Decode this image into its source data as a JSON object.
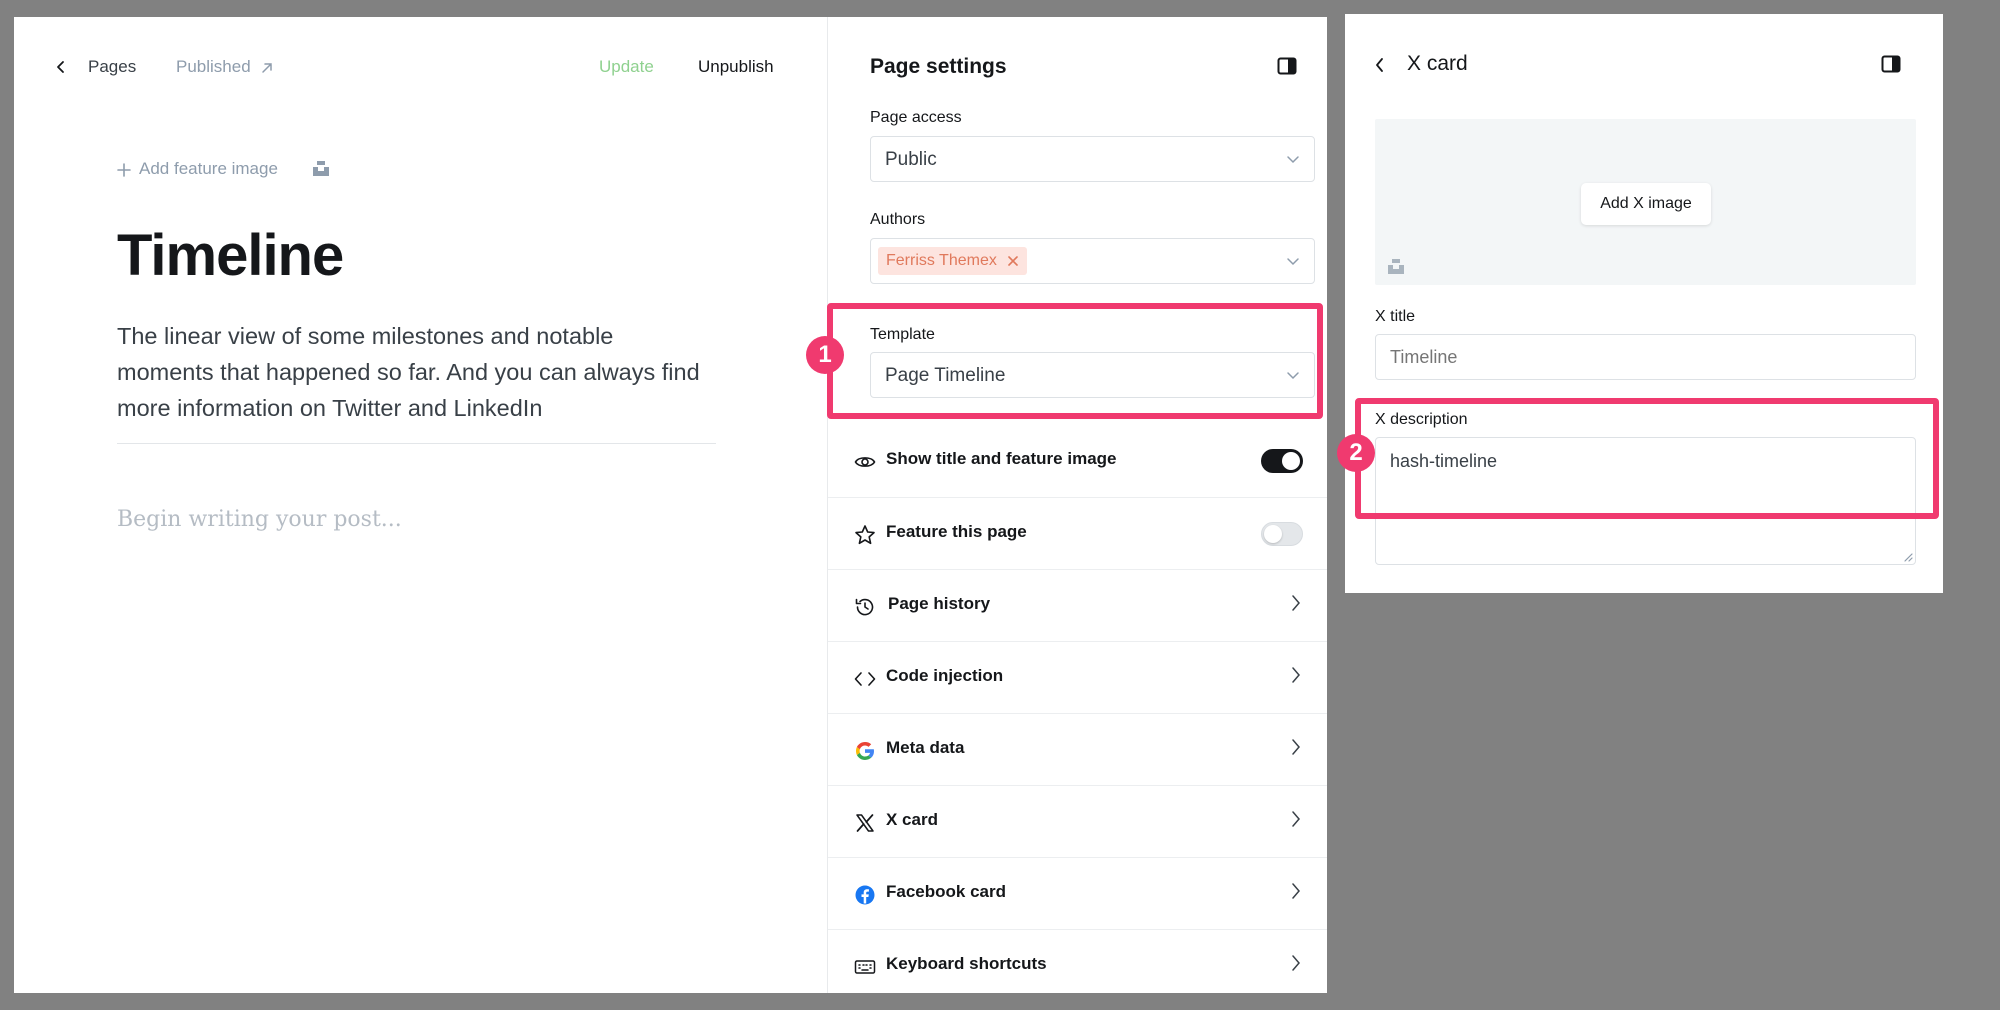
{
  "editor": {
    "back_label": "Pages",
    "status_label": "Published",
    "update_label": "Update",
    "unpublish_label": "Unpublish",
    "add_feature_image_label": "Add feature image",
    "title": "Timeline",
    "excerpt": "The linear view of some milestones and notable moments that happened so far. And you can always find more information on Twitter and LinkedIn",
    "body_placeholder": "Begin writing your post..."
  },
  "settings": {
    "heading": "Page settings",
    "page_access": {
      "label": "Page access",
      "value": "Public"
    },
    "authors": {
      "label": "Authors",
      "tag": "Ferriss Themex"
    },
    "template": {
      "label": "Template",
      "value": "Page Timeline"
    },
    "show_title": {
      "label": "Show title and feature image",
      "enabled": true
    },
    "feature_page": {
      "label": "Feature this page",
      "enabled": false
    },
    "menu": [
      {
        "label": "Page history",
        "icon": "history-icon"
      },
      {
        "label": "Code injection",
        "icon": "code-icon"
      },
      {
        "label": "Meta data",
        "icon": "google-icon"
      },
      {
        "label": "X card",
        "icon": "x-logo-icon"
      },
      {
        "label": "Facebook card",
        "icon": "facebook-icon"
      },
      {
        "label": "Keyboard shortcuts",
        "icon": "keyboard-icon"
      }
    ]
  },
  "xcard": {
    "title": "X card",
    "add_image_label": "Add X image",
    "x_title_label": "X title",
    "x_title_placeholder": "Timeline",
    "x_description_label": "X description",
    "x_description_value": "hash-timeline"
  },
  "annotations": [
    {
      "number": "1"
    },
    {
      "number": "2"
    }
  ],
  "colors": {
    "highlight": "#f03a6f",
    "update_green": "#8fd18f",
    "author_tag_bg": "#fde4df",
    "author_tag_text": "#e0795c"
  }
}
